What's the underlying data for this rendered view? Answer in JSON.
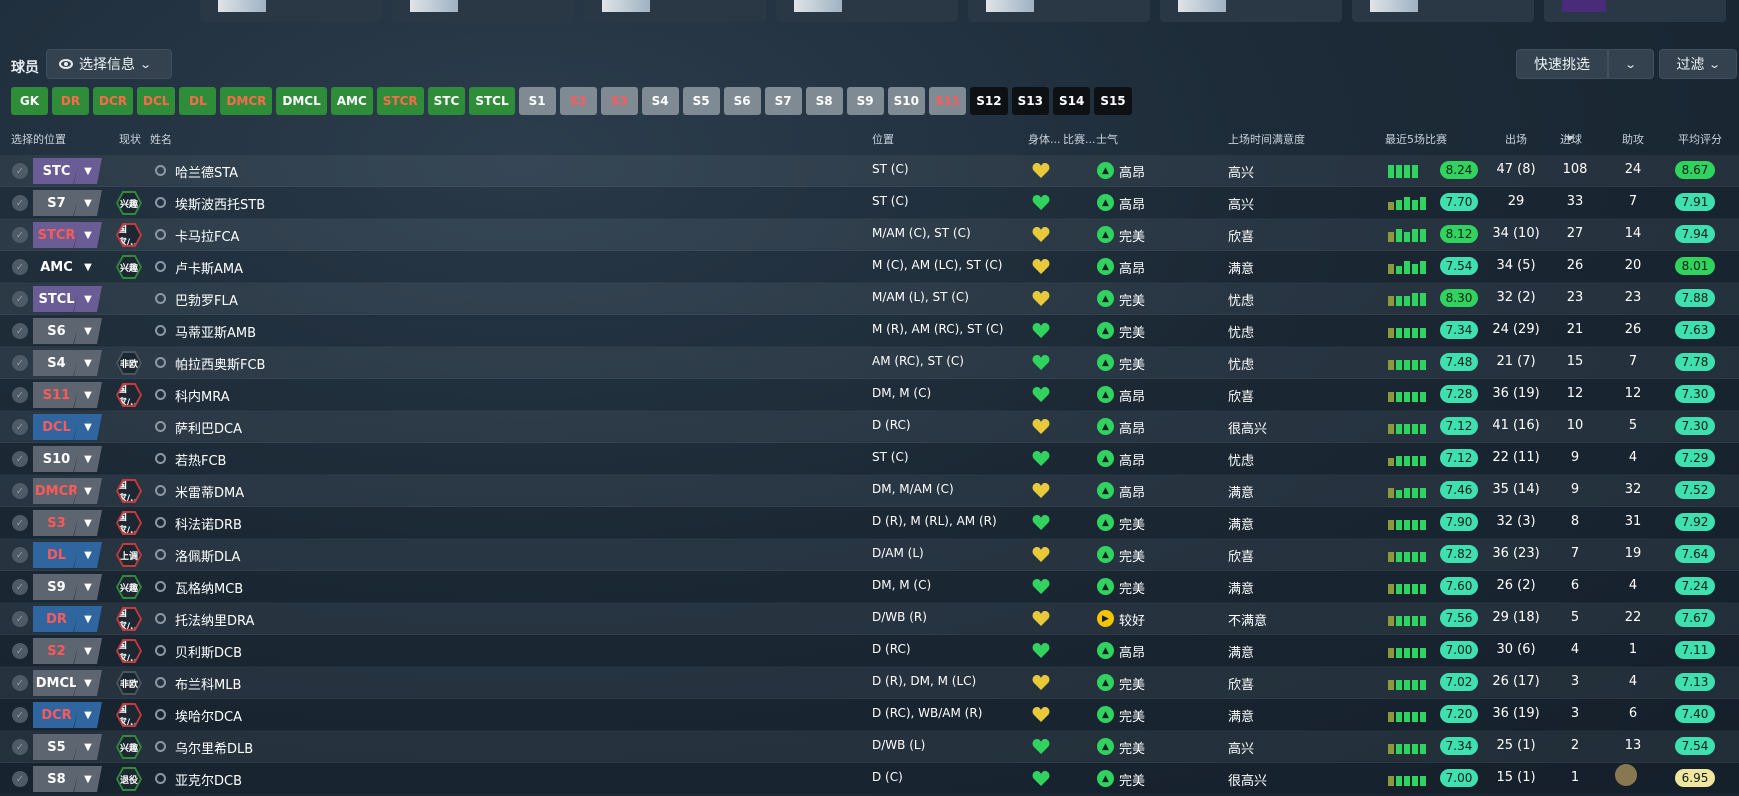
{
  "header": {
    "title": "球员",
    "select_info_label": "选择信息",
    "quick_pick_label": "快速挑选",
    "filter_label": "过滤"
  },
  "position_chips": [
    {
      "label": "GK",
      "style": "green"
    },
    {
      "label": "DR",
      "style": "green-red"
    },
    {
      "label": "DCR",
      "style": "green-red"
    },
    {
      "label": "DCL",
      "style": "green-red"
    },
    {
      "label": "DL",
      "style": "green-red"
    },
    {
      "label": "DMCR",
      "style": "green-red"
    },
    {
      "label": "DMCL",
      "style": "green"
    },
    {
      "label": "AMC",
      "style": "green"
    },
    {
      "label": "STCR",
      "style": "green-red"
    },
    {
      "label": "STC",
      "style": "green"
    },
    {
      "label": "STCL",
      "style": "green"
    },
    {
      "label": "S1",
      "style": "grey"
    },
    {
      "label": "S2",
      "style": "grey-red"
    },
    {
      "label": "S3",
      "style": "grey-red"
    },
    {
      "label": "S4",
      "style": "grey"
    },
    {
      "label": "S5",
      "style": "grey"
    },
    {
      "label": "S6",
      "style": "grey"
    },
    {
      "label": "S7",
      "style": "grey"
    },
    {
      "label": "S8",
      "style": "grey"
    },
    {
      "label": "S9",
      "style": "grey"
    },
    {
      "label": "S10",
      "style": "grey"
    },
    {
      "label": "S11",
      "style": "grey-red"
    },
    {
      "label": "S12",
      "style": "black"
    },
    {
      "label": "S13",
      "style": "black"
    },
    {
      "label": "S14",
      "style": "black"
    },
    {
      "label": "S15",
      "style": "black"
    }
  ],
  "columns": {
    "selected_position": "选择的位置",
    "status": "现状",
    "name": "姓名",
    "position": "位置",
    "condition": "身体...",
    "match": "比赛...",
    "morale": "士气",
    "playing_time": "上场时间满意度",
    "last5": "最近5场比赛",
    "apps": "出场",
    "goals": "进球",
    "assists": "助攻",
    "avg_rating": "平均评分"
  },
  "players": [
    {
      "sel": "STC",
      "sel_style": "purple",
      "status": "",
      "name": "哈兰德STA",
      "position": "ST (C)",
      "heart": "yellow",
      "morale_icon": "g",
      "morale": "高昂",
      "playing_time": "高兴",
      "form": "8.24",
      "form_color": "#2fd35e",
      "apps": "47 (8)",
      "goals": "108",
      "assists": "24",
      "avg": "8.67",
      "avg_color": "#2fd35e",
      "bars": [
        3,
        3,
        3,
        3
      ]
    },
    {
      "sel": "S7",
      "sel_style": "grey",
      "status": "兴趣",
      "status_style": "xq",
      "name": "埃斯波西托STB",
      "position": "ST (C)",
      "heart": "green",
      "morale_icon": "g",
      "morale": "高昂",
      "playing_time": "高兴",
      "form": "7.70",
      "form_color": "#3fe0b0",
      "apps": "29",
      "goals": "33",
      "assists": "7",
      "avg": "7.91",
      "avg_color": "#3fe0b0",
      "bars": [
        1,
        2,
        3,
        2,
        3
      ]
    },
    {
      "sel": "STCR",
      "sel_style": "purple-red",
      "status": "国家/...",
      "status_style": "gj",
      "name": "卡马拉FCA",
      "position": "M/AM (C), ST (C)",
      "heart": "yellow",
      "morale_icon": "g",
      "morale": "完美",
      "playing_time": "欣喜",
      "form": "8.12",
      "form_color": "#2fd35e",
      "apps": "34 (10)",
      "goals": "27",
      "assists": "14",
      "avg": "7.94",
      "avg_color": "#3fe0b0",
      "bars": [
        2,
        3,
        2,
        3,
        3
      ]
    },
    {
      "sel": "AMC",
      "sel_style": "dark",
      "status": "兴趣",
      "status_style": "xq",
      "name": "卢卡斯AMA",
      "position": "M (C), AM (LC), ST (C)",
      "heart": "yellow",
      "morale_icon": "g",
      "morale": "高昂",
      "playing_time": "满意",
      "form": "7.54",
      "form_color": "#3fe0b0",
      "apps": "34 (5)",
      "goals": "26",
      "assists": "20",
      "avg": "8.01",
      "avg_color": "#2fd35e",
      "bars": [
        2,
        1,
        3,
        2,
        3
      ]
    },
    {
      "sel": "STCL",
      "sel_style": "purple",
      "status": "",
      "name": "巴勃罗FLA",
      "position": "M/AM (L), ST (C)",
      "heart": "yellow",
      "morale_icon": "g",
      "morale": "完美",
      "playing_time": "忧虑",
      "form": "8.30",
      "form_color": "#2fd35e",
      "apps": "32 (2)",
      "goals": "23",
      "assists": "23",
      "avg": "7.88",
      "avg_color": "#3fe0b0",
      "bars": [
        2,
        2,
        2,
        3,
        3
      ]
    },
    {
      "sel": "S6",
      "sel_style": "grey",
      "status": "",
      "name": "马蒂亚斯AMB",
      "position": "M (R), AM (RC), ST (C)",
      "heart": "green",
      "morale_icon": "g",
      "morale": "完美",
      "playing_time": "忧虑",
      "form": "7.34",
      "form_color": "#3fe0b0",
      "apps": "24 (29)",
      "goals": "21",
      "assists": "26",
      "avg": "7.63",
      "avg_color": "#3fe0b0",
      "bars": [
        2,
        2,
        2,
        2,
        2
      ]
    },
    {
      "sel": "S4",
      "sel_style": "grey",
      "status": "非欧",
      "status_style": "fq",
      "name": "帕拉西奥斯FCB",
      "position": "AM (RC), ST (C)",
      "heart": "green",
      "morale_icon": "g",
      "morale": "完美",
      "playing_time": "忧虑",
      "form": "7.48",
      "form_color": "#3fe0b0",
      "apps": "21 (7)",
      "goals": "15",
      "assists": "7",
      "avg": "7.78",
      "avg_color": "#3fe0b0",
      "bars": [
        2,
        2,
        2,
        2,
        2
      ]
    },
    {
      "sel": "S11",
      "sel_style": "grey-red",
      "status": "国家/...",
      "status_style": "gj",
      "name": "科内MRA",
      "position": "DM, M (C)",
      "heart": "green",
      "morale_icon": "g",
      "morale": "高昂",
      "playing_time": "欣喜",
      "form": "7.28",
      "form_color": "#3fe0b0",
      "apps": "36 (19)",
      "goals": "12",
      "assists": "12",
      "avg": "7.30",
      "avg_color": "#3fe0b0",
      "bars": [
        2,
        2,
        2,
        2,
        2
      ]
    },
    {
      "sel": "DCL",
      "sel_style": "blue",
      "status": "",
      "name": "萨利巴DCA",
      "position": "D (RC)",
      "heart": "yellow",
      "morale_icon": "g",
      "morale": "高昂",
      "playing_time": "很高兴",
      "form": "7.12",
      "form_color": "#3fe0b0",
      "apps": "41 (16)",
      "goals": "10",
      "assists": "5",
      "avg": "7.30",
      "avg_color": "#3fe0b0",
      "bars": [
        2,
        2,
        2,
        2,
        2
      ]
    },
    {
      "sel": "S10",
      "sel_style": "grey",
      "status": "",
      "name": "若热FCB",
      "position": "ST (C)",
      "heart": "green",
      "morale_icon": "g",
      "morale": "高昂",
      "playing_time": "忧虑",
      "form": "7.12",
      "form_color": "#3fe0b0",
      "apps": "22 (11)",
      "goals": "9",
      "assists": "4",
      "avg": "7.29",
      "avg_color": "#3fe0b0",
      "bars": [
        1,
        2,
        2,
        2,
        2
      ]
    },
    {
      "sel": "DMCR",
      "sel_style": "grey-red",
      "status": "国家/...",
      "status_style": "gj",
      "name": "米雷蒂DMA",
      "position": "DM, M/AM (C)",
      "heart": "yellow",
      "morale_icon": "g",
      "morale": "高昂",
      "playing_time": "满意",
      "form": "7.46",
      "form_color": "#3fe0b0",
      "apps": "35 (14)",
      "goals": "9",
      "assists": "32",
      "avg": "7.52",
      "avg_color": "#3fe0b0",
      "bars": [
        2,
        1,
        2,
        2,
        2
      ]
    },
    {
      "sel": "S3",
      "sel_style": "grey-red",
      "status": "国家/...",
      "status_style": "gj",
      "name": "科法诺DRB",
      "position": "D (R), M (RL), AM (R)",
      "heart": "green",
      "morale_icon": "g",
      "morale": "完美",
      "playing_time": "满意",
      "form": "7.90",
      "form_color": "#3fe0b0",
      "apps": "32 (3)",
      "goals": "8",
      "assists": "31",
      "avg": "7.92",
      "avg_color": "#3fe0b0",
      "bars": [
        2,
        2,
        2,
        2,
        2
      ]
    },
    {
      "sel": "DL",
      "sel_style": "blue",
      "status": "上调",
      "status_style": "sd",
      "name": "洛佩斯DLA",
      "position": "D/AM (L)",
      "heart": "yellow",
      "morale_icon": "g",
      "morale": "完美",
      "playing_time": "欣喜",
      "form": "7.82",
      "form_color": "#3fe0b0",
      "apps": "36 (23)",
      "goals": "7",
      "assists": "19",
      "avg": "7.64",
      "avg_color": "#3fe0b0",
      "bars": [
        2,
        2,
        2,
        2,
        2
      ]
    },
    {
      "sel": "S9",
      "sel_style": "grey",
      "status": "兴趣",
      "status_style": "xq",
      "name": "瓦格纳MCB",
      "position": "DM, M (C)",
      "heart": "green",
      "morale_icon": "g",
      "morale": "完美",
      "playing_time": "满意",
      "form": "7.60",
      "form_color": "#3fe0b0",
      "apps": "26 (2)",
      "goals": "6",
      "assists": "4",
      "avg": "7.24",
      "avg_color": "#3fe0b0",
      "bars": [
        2,
        2,
        2,
        2,
        2
      ]
    },
    {
      "sel": "DR",
      "sel_style": "blue",
      "status": "国家/...",
      "status_style": "gj",
      "name": "托法纳里DRA",
      "position": "D/WB (R)",
      "heart": "yellow",
      "morale_icon": "y",
      "morale": "较好",
      "playing_time": "不满意",
      "form": "7.56",
      "form_color": "#3fe0b0",
      "apps": "29 (18)",
      "goals": "5",
      "assists": "22",
      "avg": "7.67",
      "avg_color": "#3fe0b0",
      "bars": [
        2,
        2,
        2,
        2,
        2
      ]
    },
    {
      "sel": "S2",
      "sel_style": "grey-red",
      "status": "国家/...",
      "status_style": "gj",
      "name": "贝利斯DCB",
      "position": "D (RC)",
      "heart": "green",
      "morale_icon": "g",
      "morale": "高昂",
      "playing_time": "满意",
      "form": "7.00",
      "form_color": "#3fe0b0",
      "apps": "30 (6)",
      "goals": "4",
      "assists": "1",
      "avg": "7.11",
      "avg_color": "#3fe0b0",
      "bars": [
        2,
        2,
        2,
        2,
        2
      ]
    },
    {
      "sel": "DMCL",
      "sel_style": "grey",
      "status": "非欧",
      "status_style": "fq",
      "name": "布兰科MLB",
      "position": "D (R), DM, M (LC)",
      "heart": "yellow",
      "morale_icon": "g",
      "morale": "完美",
      "playing_time": "欣喜",
      "form": "7.02",
      "form_color": "#3fe0b0",
      "apps": "26 (17)",
      "goals": "3",
      "assists": "4",
      "avg": "7.13",
      "avg_color": "#3fe0b0",
      "bars": [
        2,
        2,
        2,
        2,
        2
      ]
    },
    {
      "sel": "DCR",
      "sel_style": "blue",
      "status": "国家/...",
      "status_style": "gj",
      "name": "埃哈尔DCA",
      "position": "D (RC), WB/AM (R)",
      "heart": "yellow",
      "morale_icon": "g",
      "morale": "完美",
      "playing_time": "满意",
      "form": "7.20",
      "form_color": "#3fe0b0",
      "apps": "36 (19)",
      "goals": "3",
      "assists": "6",
      "avg": "7.40",
      "avg_color": "#3fe0b0",
      "bars": [
        2,
        2,
        2,
        2,
        2
      ]
    },
    {
      "sel": "S5",
      "sel_style": "grey",
      "status": "兴趣",
      "status_style": "xq",
      "name": "乌尔里希DLB",
      "position": "D/WB (L)",
      "heart": "green",
      "morale_icon": "g",
      "morale": "完美",
      "playing_time": "高兴",
      "form": "7.34",
      "form_color": "#3fe0b0",
      "apps": "25 (1)",
      "goals": "2",
      "assists": "13",
      "avg": "7.54",
      "avg_color": "#3fe0b0",
      "bars": [
        2,
        2,
        2,
        2,
        2
      ]
    },
    {
      "sel": "S8",
      "sel_style": "grey",
      "status": "退役",
      "status_style": "ty",
      "name": "亚克尔DCB",
      "position": "D (C)",
      "heart": "green",
      "morale_icon": "g",
      "morale": "完美",
      "playing_time": "很高兴",
      "form": "7.00",
      "form_color": "#3fe0b0",
      "apps": "15 (1)",
      "goals": "1",
      "assists": "",
      "avg": "6.95",
      "avg_color": "#f0e6a0",
      "bars": [
        2,
        2,
        2,
        2,
        2
      ]
    }
  ],
  "colors": {
    "accent_green": "#2f8d3a",
    "rating_green": "#2fd35e",
    "rating_teal": "#3fe0b0",
    "warn_red": "#ff5a5a"
  }
}
